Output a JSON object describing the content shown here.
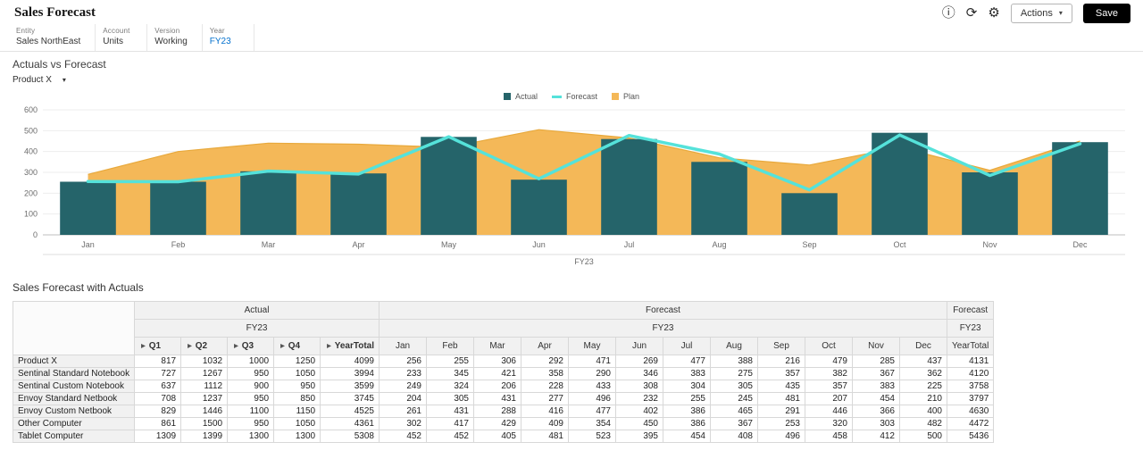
{
  "header": {
    "title": "Sales Forecast",
    "actions_label": "Actions",
    "save_label": "Save",
    "save_color": "#000000"
  },
  "pov": [
    {
      "dim": "Entity",
      "member": "Sales NorthEast"
    },
    {
      "dim": "Account",
      "member": "Units"
    },
    {
      "dim": "Version",
      "member": "Working"
    },
    {
      "dim": "Year",
      "member": "FY23",
      "highlight_color": "#0572ce"
    }
  ],
  "chart_section": {
    "title": "Actuals vs Forecast",
    "product_selector": "Product X"
  },
  "chart_data": {
    "type": "combo",
    "categories": [
      "Jan",
      "Feb",
      "Mar",
      "Apr",
      "May",
      "Jun",
      "Jul",
      "Aug",
      "Sep",
      "Oct",
      "Nov",
      "Dec"
    ],
    "series": [
      {
        "name": "Actual",
        "type": "bar",
        "color": "#25646a",
        "values": [
          255,
          255,
          305,
          295,
          470,
          265,
          460,
          350,
          200,
          490,
          300,
          445
        ]
      },
      {
        "name": "Forecast",
        "type": "line",
        "color": "#55e2da",
        "values": [
          256,
          255,
          306,
          292,
          471,
          269,
          477,
          388,
          216,
          479,
          285,
          437
        ]
      },
      {
        "name": "Plan",
        "type": "area",
        "color": "#f4b858",
        "values": [
          290,
          400,
          440,
          435,
          420,
          505,
          465,
          370,
          335,
          420,
          310,
          450
        ]
      }
    ],
    "ylim": [
      0,
      600
    ],
    "yticks": [
      0,
      100,
      200,
      300,
      400,
      500,
      600
    ],
    "axis_group_label": "FY23",
    "legend_position": "top"
  },
  "table": {
    "title": "Sales Forecast with Actuals",
    "groups": [
      {
        "label": "Actual",
        "span": 5
      },
      {
        "label": "Forecast",
        "span": 12
      },
      {
        "label": "Forecast",
        "span": 1
      }
    ],
    "subgroups": [
      {
        "label": "FY23",
        "span": 5
      },
      {
        "label": "FY23",
        "span": 12
      },
      {
        "label": "FY23",
        "span": 1
      }
    ],
    "columns": [
      {
        "label": "Q1",
        "expandable": true
      },
      {
        "label": "Q2",
        "expandable": true
      },
      {
        "label": "Q3",
        "expandable": true
      },
      {
        "label": "Q4",
        "expandable": true
      },
      {
        "label": "YearTotal",
        "expandable": true
      },
      {
        "label": "Jan"
      },
      {
        "label": "Feb"
      },
      {
        "label": "Mar"
      },
      {
        "label": "Apr"
      },
      {
        "label": "May"
      },
      {
        "label": "Jun"
      },
      {
        "label": "Jul"
      },
      {
        "label": "Aug"
      },
      {
        "label": "Sep"
      },
      {
        "label": "Oct"
      },
      {
        "label": "Nov"
      },
      {
        "label": "Dec"
      },
      {
        "label": "YearTotal"
      }
    ],
    "rows": [
      {
        "name": "Product X",
        "values": [
          817,
          1032,
          1000,
          1250,
          4099,
          256,
          255,
          306,
          292,
          471,
          269,
          477,
          388,
          216,
          479,
          285,
          437,
          4131
        ]
      },
      {
        "name": "Sentinal Standard Notebook",
        "values": [
          727,
          1267,
          950,
          1050,
          3994,
          233,
          345,
          421,
          358,
          290,
          346,
          383,
          275,
          357,
          382,
          367,
          362,
          4120
        ]
      },
      {
        "name": "Sentinal Custom Notebook",
        "values": [
          637,
          1112,
          900,
          950,
          3599,
          249,
          324,
          206,
          228,
          433,
          308,
          304,
          305,
          435,
          357,
          383,
          225,
          3758
        ]
      },
      {
        "name": "Envoy Standard Netbook",
        "values": [
          708,
          1237,
          950,
          850,
          3745,
          204,
          305,
          431,
          277,
          496,
          232,
          255,
          245,
          481,
          207,
          454,
          210,
          3797
        ]
      },
      {
        "name": "Envoy Custom Netbook",
        "values": [
          829,
          1446,
          1100,
          1150,
          4525,
          261,
          431,
          288,
          416,
          477,
          402,
          386,
          465,
          291,
          446,
          366,
          400,
          4630
        ]
      },
      {
        "name": "Other Computer",
        "values": [
          861,
          1500,
          950,
          1050,
          4361,
          302,
          417,
          429,
          409,
          354,
          450,
          386,
          367,
          253,
          320,
          303,
          482,
          4472
        ]
      },
      {
        "name": "Tablet Computer",
        "values": [
          1309,
          1399,
          1300,
          1300,
          5308,
          452,
          452,
          405,
          481,
          523,
          395,
          454,
          408,
          496,
          458,
          412,
          500,
          5436
        ]
      }
    ]
  },
  "icons": {
    "info": "info-icon",
    "refresh": "refresh-icon",
    "settings": "gear-icon"
  }
}
